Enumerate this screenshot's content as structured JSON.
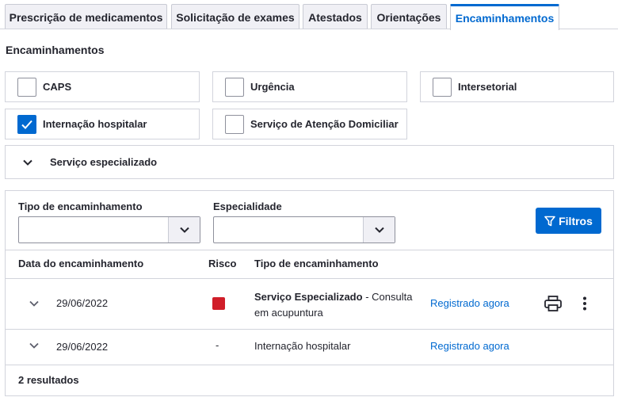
{
  "tabs": [
    {
      "label": "Prescrição de medicamentos",
      "active": false
    },
    {
      "label": "Solicitação de exames",
      "active": false
    },
    {
      "label": "Atestados",
      "active": false
    },
    {
      "label": "Orientações",
      "active": false
    },
    {
      "label": "Encaminhamentos",
      "active": true
    }
  ],
  "section_title": "Encaminhamentos",
  "checkboxes": [
    {
      "label": "CAPS",
      "checked": false
    },
    {
      "label": "Urgência",
      "checked": false
    },
    {
      "label": "Intersetorial",
      "checked": false
    },
    {
      "label": "Internação hospitalar",
      "checked": true
    },
    {
      "label": "Serviço de Atenção Domiciliar",
      "checked": false
    }
  ],
  "accordion": {
    "label": "Serviço especializado"
  },
  "filters": {
    "tipo_label": "Tipo de encaminhamento",
    "tipo_value": "",
    "especialidade_label": "Especialidade",
    "especialidade_value": "",
    "button_label": "Filtros"
  },
  "table": {
    "headers": {
      "data": "Data do encaminhamento",
      "risco": "Risco",
      "tipo": "Tipo de encaminhamento"
    },
    "rows": [
      {
        "date": "29/06/2022",
        "risk": "red",
        "tipo_bold": "Serviço Especializado",
        "tipo_rest": " - Consulta em acupuntura",
        "status": "Registrado agora"
      },
      {
        "date": "29/06/2022",
        "risk": "-",
        "tipo": "Internação hospitalar",
        "status": "Registrado agora"
      }
    ],
    "result_count": "2 resultados"
  },
  "colors": {
    "accent": "#0069d0",
    "risk_high": "#d01e29",
    "border": "#d2d4dc"
  }
}
